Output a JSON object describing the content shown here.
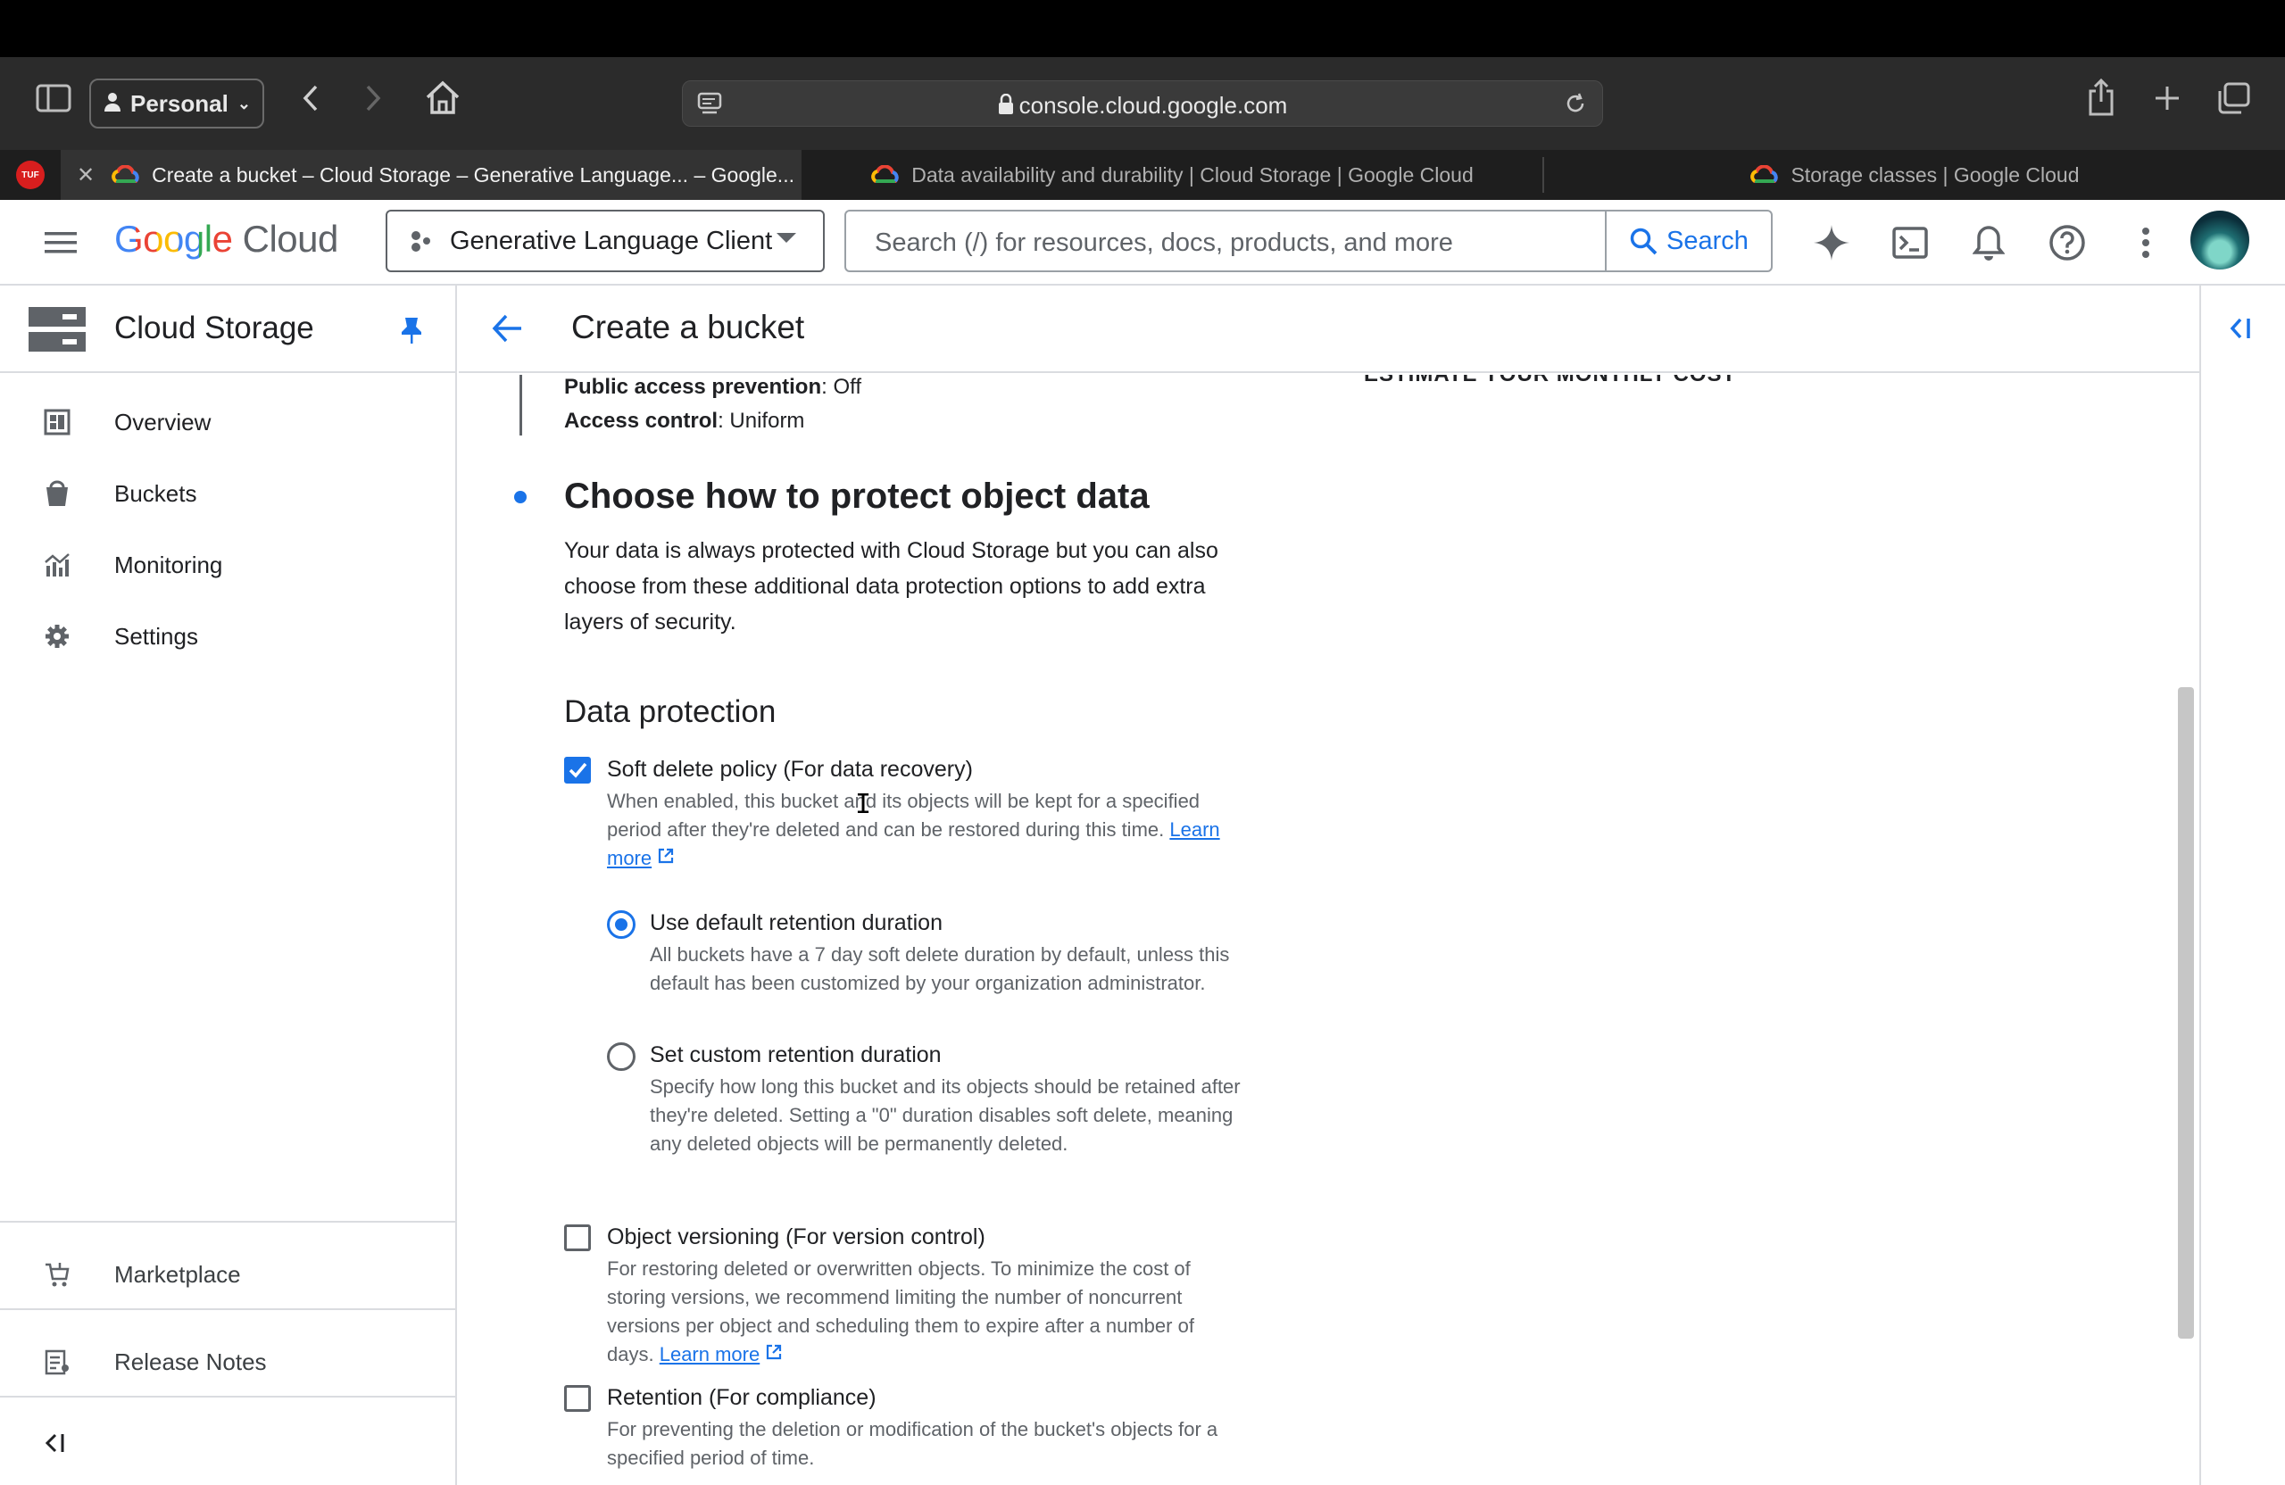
{
  "browser": {
    "profile_label": "Personal",
    "url": "console.cloud.google.com",
    "tabs": [
      {
        "title": "Create a bucket – Cloud Storage – Generative Language... – Google...",
        "active": true
      },
      {
        "title": "Data availability and durability  |  Cloud Storage  |  Google Cloud",
        "active": false
      },
      {
        "title": "Storage classes  |  Google Cloud",
        "active": false
      }
    ],
    "pinned_tab_label": "TUF"
  },
  "header": {
    "logo_google": "Google",
    "logo_cloud": "Cloud",
    "project_name": "Generative Language Client",
    "search_placeholder": "Search (/) for resources, docs, products, and more",
    "search_button": "Search"
  },
  "sidebar": {
    "title": "Cloud Storage",
    "items": [
      {
        "label": "Overview",
        "icon": "dashboard-icon"
      },
      {
        "label": "Buckets",
        "icon": "bucket-icon"
      },
      {
        "label": "Monitoring",
        "icon": "monitoring-icon"
      },
      {
        "label": "Settings",
        "icon": "gear-icon"
      }
    ],
    "bottom_items": [
      {
        "label": "Marketplace",
        "icon": "cart-icon"
      },
      {
        "label": "Release Notes",
        "icon": "release-notes-icon"
      }
    ]
  },
  "page": {
    "title": "Create a bucket",
    "estimate_cut": "ESTIMATE YOUR MONTHLY COST",
    "summary": [
      {
        "key": "Public access prevention",
        "value": ": Off"
      },
      {
        "key": "Access control",
        "value": ": Uniform"
      }
    ],
    "section_title": "Choose how to protect object data",
    "section_desc": "Your data is always protected with Cloud Storage but you can also choose from these additional data protection options to add extra layers of security.",
    "data_protection_heading": "Data protection",
    "soft_delete": {
      "label": "Soft delete policy (For data recovery)",
      "checked": true,
      "desc": "When enabled, this bucket and its objects will be kept for a specified period after they're deleted and can be restored during this time.",
      "learn_more": "Learn more"
    },
    "retention_options": [
      {
        "label": "Use default retention duration",
        "selected": true,
        "desc": "All buckets have a 7 day soft delete duration by default, unless this default has been customized by your organization administrator."
      },
      {
        "label": "Set custom retention duration",
        "selected": false,
        "desc": "Specify how long this bucket and its objects should be retained after they're deleted. Setting a \"0\" duration disables soft delete, meaning any deleted objects will be permanently deleted."
      }
    ],
    "versioning": {
      "label": "Object versioning (For version control)",
      "checked": false,
      "desc": "For restoring deleted or overwritten objects. To minimize the cost of storing versions, we recommend limiting the number of noncurrent versions per object and scheduling them to expire after a number of days.",
      "learn_more": "Learn more"
    },
    "retention": {
      "label": "Retention (For compliance)",
      "checked": false,
      "desc": "For preventing the deletion or modification of the bucket's objects for a specified period of time."
    }
  },
  "colors": {
    "accent": "#1a73e8",
    "text": "#202124",
    "secondary_text": "#5f6368"
  }
}
